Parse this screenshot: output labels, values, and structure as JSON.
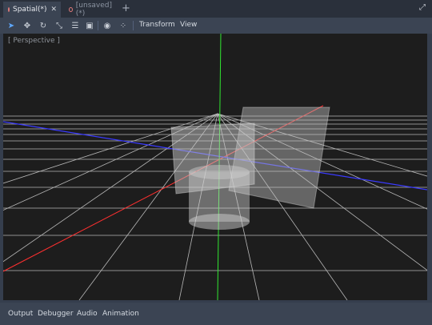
{
  "tabs": [
    {
      "label": "Spatial(*)",
      "active": true
    },
    {
      "label": "[unsaved](*)",
      "active": false
    }
  ],
  "toolbar": {
    "tools": [
      "select-icon",
      "move-icon",
      "rotate-icon",
      "scale-icon",
      "list-icon",
      "lock-icon",
      "group-icon",
      "snap-icon"
    ],
    "menus": [
      "Transform",
      "View"
    ]
  },
  "viewport": {
    "label": "[ Perspective ]"
  },
  "bottom_tabs": [
    "Output",
    "Debugger",
    "Audio",
    "Animation"
  ],
  "colors": {
    "x_axis": "#ff3b3b",
    "y_axis": "#31ff31",
    "z_axis": "#3a3aff",
    "grid": "#cfcfcf",
    "background": "#1d1d1d"
  }
}
